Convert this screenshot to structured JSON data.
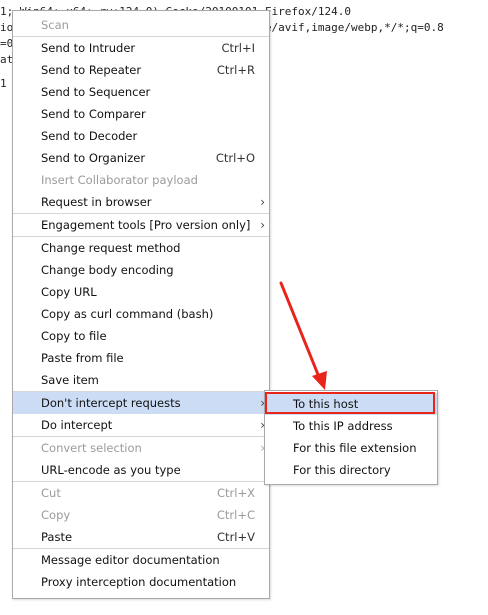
{
  "editor_lines": [
    "1; Win64; x64; rv:124.0) Gecko/20100101 Firefox/124.0",
    "ion/xhtml+xml,application/xml;q=0.9,image/avif,image/webp,*/*;q=0.8",
    "=0.5",
    "at",
    "",
    "1"
  ],
  "context_menu": {
    "items": [
      {
        "label": "Scan",
        "disabled": true
      },
      {
        "label": "Send to Intruder",
        "shortcut": "Ctrl+I"
      },
      {
        "label": "Send to Repeater",
        "shortcut": "Ctrl+R"
      },
      {
        "label": "Send to Sequencer"
      },
      {
        "label": "Send to Comparer"
      },
      {
        "label": "Send to Decoder"
      },
      {
        "label": "Send to Organizer",
        "shortcut": "Ctrl+O"
      },
      {
        "label": "Insert Collaborator payload",
        "disabled": true
      },
      {
        "label": "Request in browser",
        "submenu": true
      },
      {
        "label": "Engagement tools [Pro version only]",
        "submenu": true
      },
      {
        "label": "Change request method"
      },
      {
        "label": "Change body encoding"
      },
      {
        "label": "Copy URL"
      },
      {
        "label": "Copy as curl command (bash)"
      },
      {
        "label": "Copy to file"
      },
      {
        "label": "Paste from file"
      },
      {
        "label": "Save item"
      },
      {
        "label": "Don't intercept requests",
        "submenu": true,
        "highlighted": true
      },
      {
        "label": "Do intercept",
        "submenu": true
      },
      {
        "label": "Convert selection",
        "disabled": true,
        "submenu": true
      },
      {
        "label": "URL-encode as you type"
      },
      {
        "label": "Cut",
        "shortcut": "Ctrl+X",
        "disabled": true
      },
      {
        "label": "Copy",
        "shortcut": "Ctrl+C",
        "disabled": true
      },
      {
        "label": "Paste",
        "shortcut": "Ctrl+V"
      },
      {
        "label": "Message editor documentation"
      },
      {
        "label": "Proxy interception documentation"
      }
    ]
  },
  "submenu": {
    "items": [
      {
        "label": "To this host",
        "highlighted": true
      },
      {
        "label": "To this IP address"
      },
      {
        "label": "For this file extension"
      },
      {
        "label": "For this directory"
      }
    ]
  },
  "colors": {
    "highlight": "#cbdcf4",
    "annotation_red": "#e8241b",
    "disabled_text": "#9b9b9b"
  },
  "icons": {
    "submenu_arrow": "chevron-right-icon"
  }
}
